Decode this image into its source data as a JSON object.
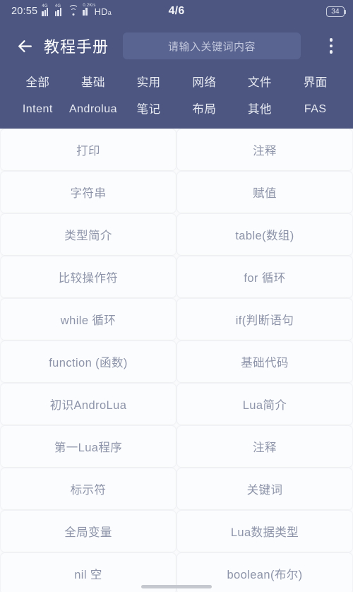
{
  "status_bar": {
    "clock": "20:55",
    "network_label": "HD",
    "network_sub": "a",
    "sim1_gen": "4G",
    "sim2_gen": "4G",
    "data_rate": "0.2K/s",
    "page_indicator": "4/6",
    "battery_level": "34"
  },
  "toolbar": {
    "back_icon": "arrow-left-icon",
    "title": "教程手册",
    "search_placeholder": "请输入关键词内容",
    "overflow_icon": "more-vertical-icon"
  },
  "tabs": {
    "row1": [
      {
        "label": "全部",
        "latin": false
      },
      {
        "label": "基础",
        "latin": false
      },
      {
        "label": "实用",
        "latin": false
      },
      {
        "label": "网络",
        "latin": false
      },
      {
        "label": "文件",
        "latin": false
      },
      {
        "label": "界面",
        "latin": false
      }
    ],
    "row2": [
      {
        "label": "Intent",
        "latin": true
      },
      {
        "label": "Androlua",
        "latin": true
      },
      {
        "label": "笔记",
        "latin": false
      },
      {
        "label": "布局",
        "latin": false
      },
      {
        "label": "其他",
        "latin": false
      },
      {
        "label": "FAS",
        "latin": true
      }
    ]
  },
  "list": {
    "items": [
      "打印",
      "注释",
      "字符串",
      "赋值",
      "类型简介",
      "table(数组)",
      "比较操作符",
      "for 循环",
      "while 循环",
      "if(判断语句",
      "function (函数)",
      "基础代码",
      "初识AndroLua",
      "Lua简介",
      "第一Lua程序",
      "注释",
      "标示符",
      "关键词",
      "全局变量",
      "Lua数据类型",
      "nil 空",
      "boolean(布尔)"
    ]
  },
  "colors": {
    "header_bg": "#4c5680",
    "search_bg": "#5a6490",
    "page_bg": "#fafbfc",
    "card_bg": "#fbfcfd",
    "card_text": "#8d94a9",
    "header_text": "#ffffff"
  },
  "system": {
    "home_indicator": "home-indicator"
  }
}
